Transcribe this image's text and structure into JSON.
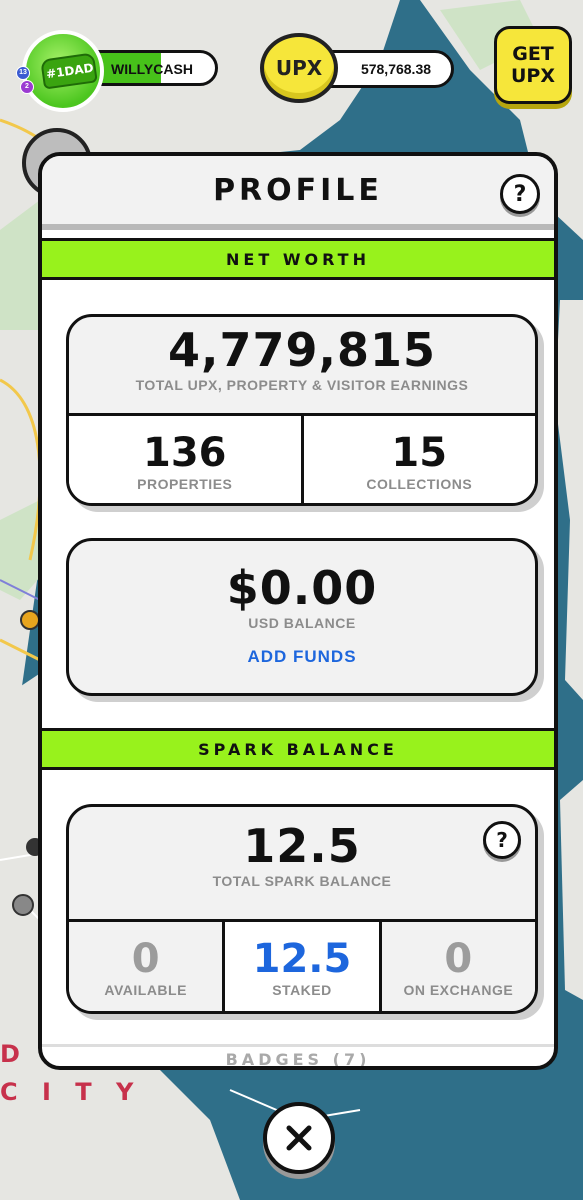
{
  "hud": {
    "avatar": {
      "cap_text": "#1DAD",
      "level_badges": [
        "13",
        "2"
      ]
    },
    "username": "WILLYCASH",
    "upx_coin_label": "UPX",
    "upx_balance": "578,768.38",
    "get_upx_label": "GET\nUPX"
  },
  "map": {
    "city_label_line1": "D A",
    "city_label_line2": "C I T Y"
  },
  "profile": {
    "title": "PROFILE",
    "help_icon": "?",
    "net_worth": {
      "banner": "NET WORTH",
      "total_value": "4,779,815",
      "total_label": "TOTAL UPX, PROPERTY & VISITOR EARNINGS",
      "properties_value": "136",
      "properties_label": "PROPERTIES",
      "collections_value": "15",
      "collections_label": "COLLECTIONS"
    },
    "usd": {
      "value": "$0.00",
      "label": "USD BALANCE",
      "add_funds_label": "ADD FUNDS"
    },
    "spark": {
      "banner": "SPARK BALANCE",
      "total_value": "12.5",
      "total_label": "TOTAL SPARK BALANCE",
      "help_icon": "?",
      "available_value": "0",
      "available_label": "AVAILABLE",
      "staked_value": "12.5",
      "staked_label": "STAKED",
      "exchange_value": "0",
      "exchange_label": "ON EXCHANGE"
    },
    "badges_peek": "BADGES (7)"
  },
  "colors": {
    "accent_green": "#98f21c",
    "link_blue": "#1d66dd",
    "coin_yellow": "#f6e63a",
    "water": "#2f6f89"
  }
}
